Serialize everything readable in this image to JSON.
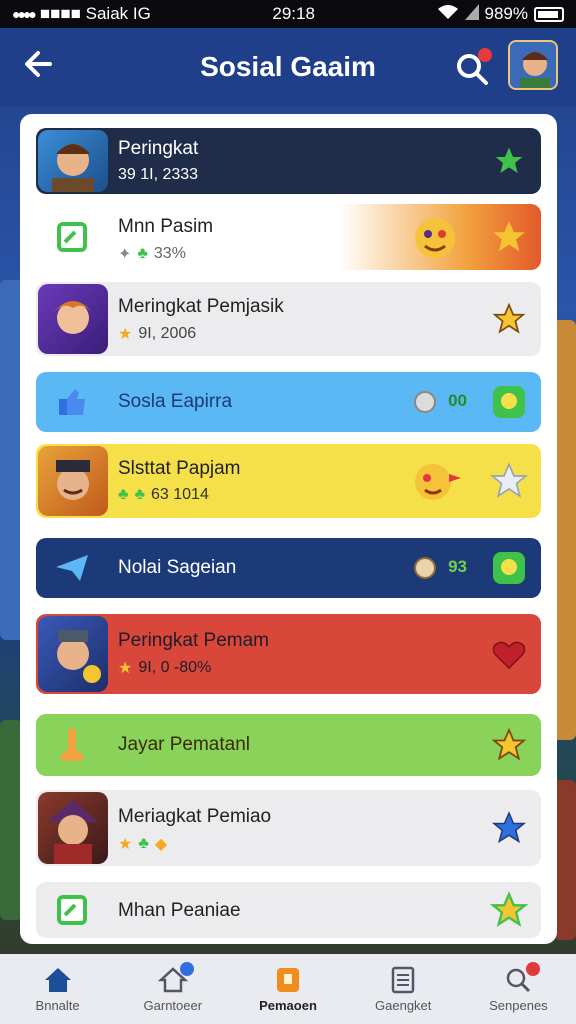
{
  "status_bar": {
    "carrier": "■■■■ Saiak IG",
    "time": "29:18",
    "battery": "989%"
  },
  "header": {
    "title": "Sosial Gaaim"
  },
  "rows": [
    {
      "title": "Peringkat",
      "sub": "39 1I, 2333",
      "icon": "star-icon"
    },
    {
      "title": "Mnn Pasim",
      "sub": "33%",
      "icon": "star-icon"
    },
    {
      "title": "Meringkat Pemjasik",
      "sub": "9I, 2006",
      "icon": "star-icon"
    },
    {
      "title": "Sosla Eapirra",
      "badge": "00",
      "icon": "green-badge-icon"
    },
    {
      "title": "Slsttat Papjam",
      "sub": "63 1014",
      "icon": "silver-star-icon"
    },
    {
      "title": "Nolai Sageian",
      "badge": "93",
      "icon": "green-badge-icon"
    },
    {
      "title": "Peringkat Pemam",
      "sub": "9I, 0 -80%",
      "icon": "heart-icon"
    },
    {
      "title": "Jayar Pematanl",
      "icon": "star-icon"
    },
    {
      "title": "Meriagkat Pemiao",
      "icon": "blue-star-icon"
    },
    {
      "title": "Mhan Peaniae",
      "icon": "sparkle-star-icon"
    }
  ],
  "tabs": [
    {
      "label": "Bnnalte"
    },
    {
      "label": "Garntoeer"
    },
    {
      "label": "Pemaoen"
    },
    {
      "label": "Gaengket"
    },
    {
      "label": "Senpenes"
    }
  ],
  "colors": {
    "header_bg": "#1f3f8a",
    "row_dark": "#1f2d4a",
    "row_blue": "#5ab8f5",
    "row_yellow": "#f6e04a",
    "row_navy": "#1d3a78",
    "row_red": "#d9473a",
    "row_green": "#8ad35a",
    "row_light": "#ececef",
    "active_tab": "#f28c1d"
  }
}
